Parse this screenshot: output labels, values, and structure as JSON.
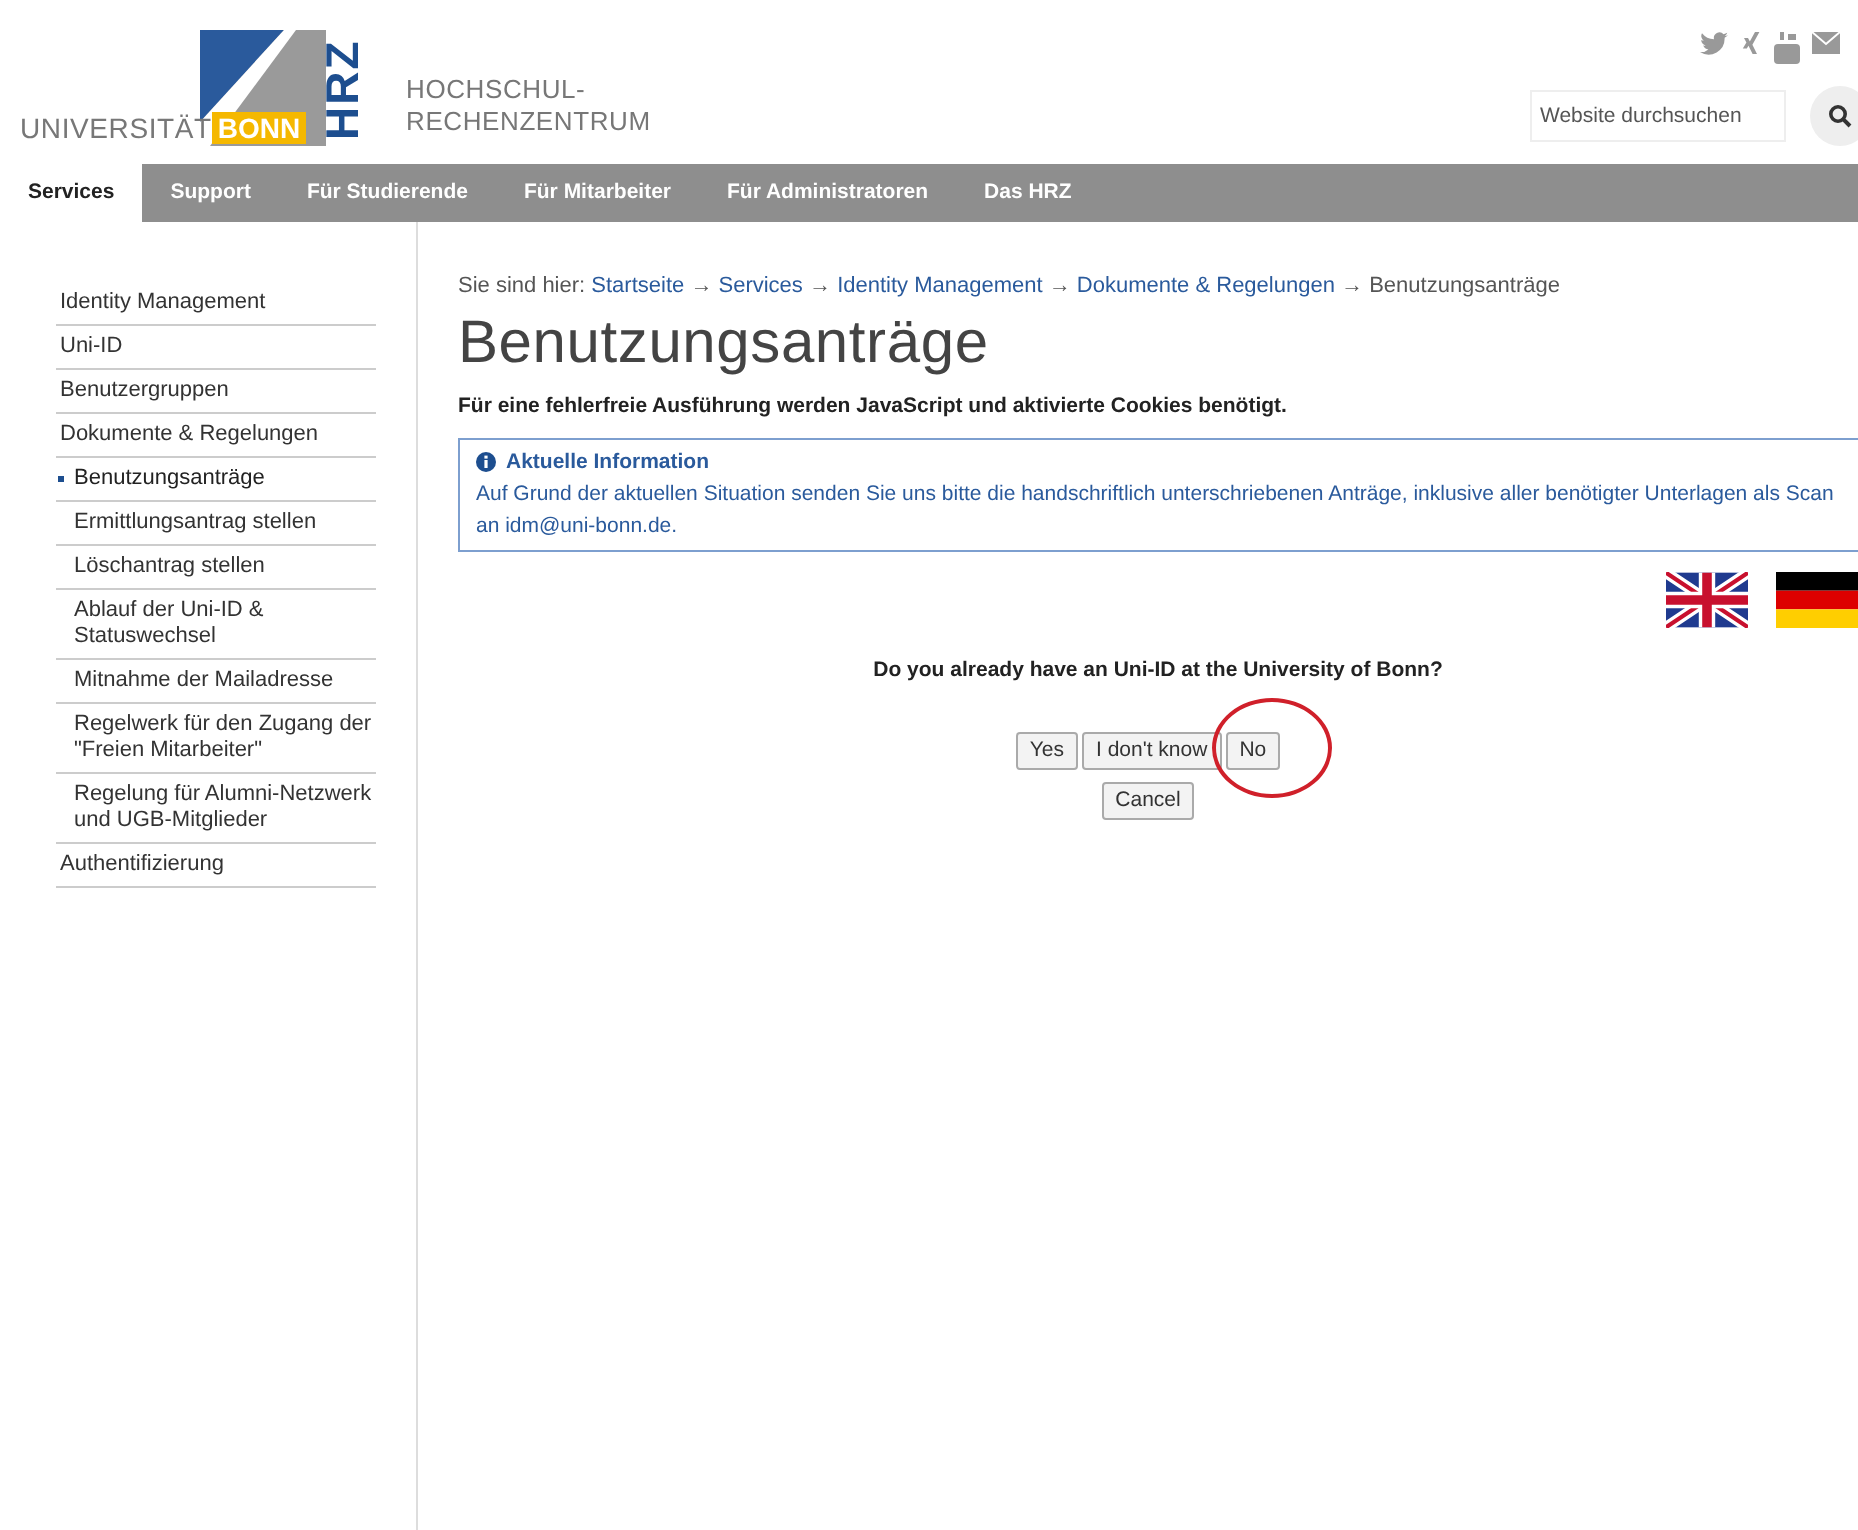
{
  "header": {
    "university_logo": {
      "word": "UNIVERSITÄT",
      "highlight": "BONN"
    },
    "hrz_logo": {
      "letters": "HRZ",
      "lines": [
        "HOCHSCHUL-",
        "RECHENZENTRUM"
      ]
    },
    "search": {
      "placeholder": "Website durchsuchen"
    }
  },
  "nav": [
    {
      "label": "Services",
      "selected": true
    },
    {
      "label": "Support",
      "selected": false
    },
    {
      "label": "Für Studierende",
      "selected": false
    },
    {
      "label": "Für Mitarbeiter",
      "selected": false
    },
    {
      "label": "Für Administratoren",
      "selected": false
    },
    {
      "label": "Das HRZ",
      "selected": false
    }
  ],
  "sidebar": {
    "heading": "Identity Management",
    "items": [
      {
        "label": "Uni-ID",
        "selected": false
      },
      {
        "label": "Benutzergruppen",
        "selected": false
      },
      {
        "label": "Dokumente & Regelungen",
        "selected": false,
        "children": [
          {
            "label": "Benutzungsanträge",
            "selected": true,
            "children": [
              {
                "label": "Ermittlungsantrag stellen",
                "selected": false
              },
              {
                "label": "Löschantrag stellen",
                "selected": false
              },
              {
                "label": "Ablauf der Uni-ID & Statuswechsel",
                "selected": false
              },
              {
                "label": "Mitnahme der Mailadresse",
                "selected": false
              },
              {
                "label": "Regelwerk für den Zugang der \"Freien Mitarbeiter\"",
                "selected": false
              },
              {
                "label": "Regelung für Alumni-Netzwerk und UGB-Mitglieder",
                "selected": false
              }
            ]
          }
        ]
      },
      {
        "label": "Authentifizierung",
        "selected": false
      }
    ]
  },
  "breadcrumb": {
    "label": "Sie sind hier:",
    "items": [
      {
        "text": "Startseite",
        "link": true
      },
      {
        "sep": "→",
        "text": "Services",
        "link": true
      },
      {
        "sep": "→",
        "text": "Identity Management",
        "link": true
      },
      {
        "sep": "→",
        "text": "Dokumente & Regelungen",
        "link": true
      },
      {
        "sep": "→",
        "text": "Benutzungsanträge",
        "link": false
      }
    ]
  },
  "page_title": "Benutzungsanträge",
  "notice": "Für eine fehlerfreie Ausführung werden JavaScript und aktivierte Cookies benötigt.",
  "info_box": {
    "title": "Aktuelle Information",
    "text": "Auf Grund der aktuellen Situation senden Sie uns bitte die handschriftlich unterschriebenen Anträge, inklusive aller benötigter Unterlagen als Scan an idm@uni-bonn.de."
  },
  "question": "Do you already have an Uni-ID at the University of Bonn?",
  "answer_buttons": [
    {
      "label": "Yes",
      "circled": false
    },
    {
      "label": "I don't know",
      "circled": false
    },
    {
      "label": "No",
      "circled": true
    }
  ],
  "cancel_button": "Cancel"
}
